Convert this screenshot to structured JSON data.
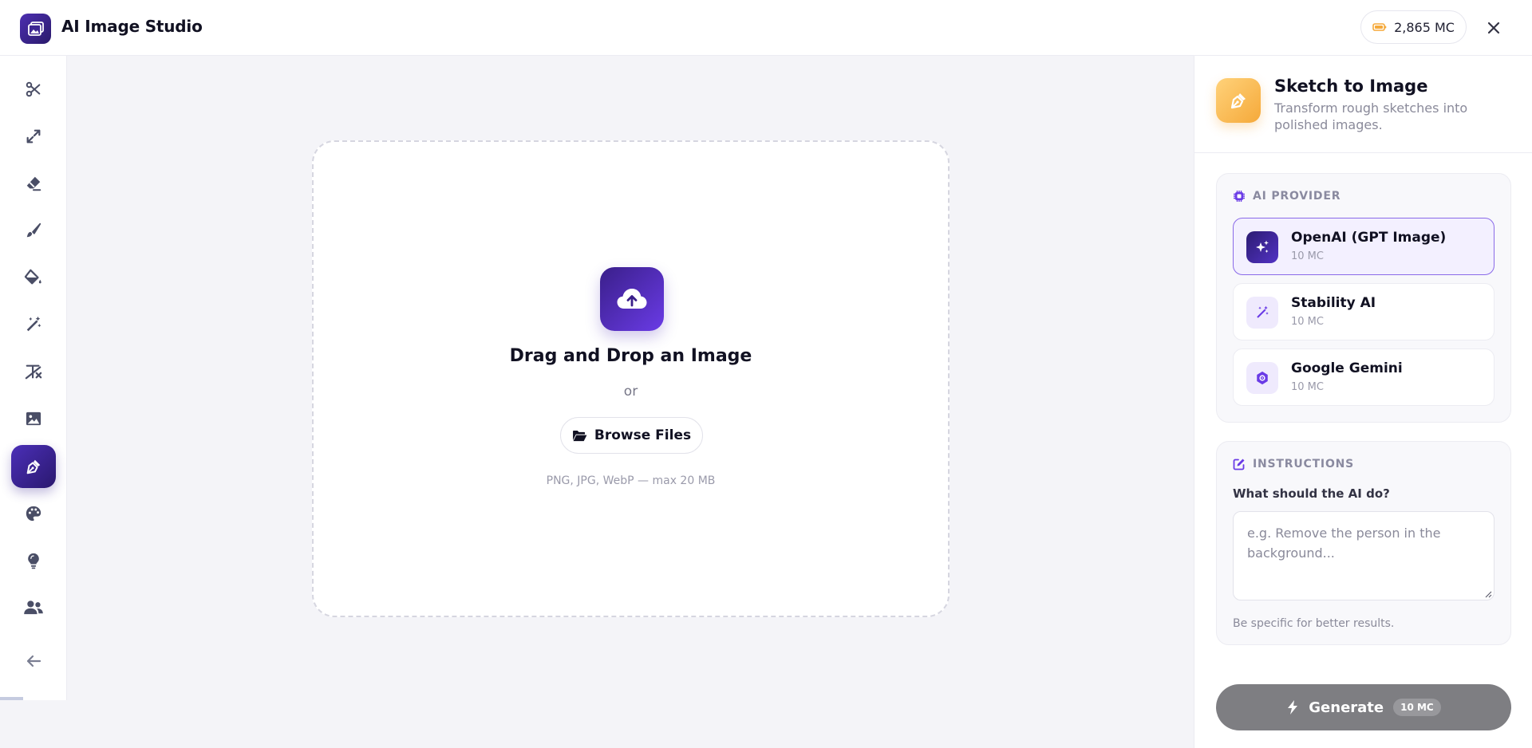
{
  "header": {
    "app_title": "AI Image Studio",
    "credits": "2,865 MC"
  },
  "sidebar": {
    "items": [
      {
        "icon": "scissors-icon"
      },
      {
        "icon": "expand-icon"
      },
      {
        "icon": "eraser-icon"
      },
      {
        "icon": "brush-icon"
      },
      {
        "icon": "paint-bucket-icon"
      },
      {
        "icon": "magic-wand-icon"
      },
      {
        "icon": "remove-text-icon"
      },
      {
        "icon": "image-icon"
      },
      {
        "icon": "pen-nib-icon",
        "active": true
      },
      {
        "icon": "palette-icon"
      },
      {
        "icon": "lightbulb-icon"
      },
      {
        "icon": "users-icon"
      },
      {
        "icon": "arrow-left-icon"
      }
    ]
  },
  "dropzone": {
    "title": "Drag and Drop an Image",
    "or": "or",
    "browse_label": "Browse Files",
    "hint": "PNG, JPG, WebP — max 20 MB"
  },
  "panel": {
    "tool_title": "Sketch to Image",
    "tool_subtitle": "Transform rough sketches into polished images.",
    "provider_heading": "AI PROVIDER",
    "providers": [
      {
        "name": "OpenAI (GPT Image)",
        "cost": "10 MC",
        "selected": true
      },
      {
        "name": "Stability AI",
        "cost": "10 MC"
      },
      {
        "name": "Google Gemini",
        "cost": "10 MC"
      }
    ],
    "instructions_heading": "INSTRUCTIONS",
    "instructions_label": "What should the AI do?",
    "instructions_value": "",
    "instructions_placeholder": "e.g. Remove the person in the background...",
    "instructions_hint": "Be specific for better results.",
    "generate_label": "Generate",
    "generate_cost": "10 MC"
  },
  "colors": {
    "accent": "#4b2fb8",
    "tool_icon": "#f5a93a",
    "generate_disabled": "#7e7e82"
  }
}
